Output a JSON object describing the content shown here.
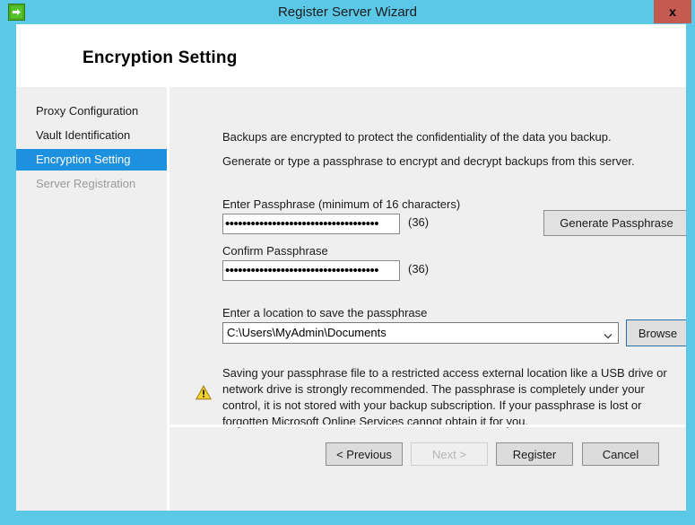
{
  "window": {
    "title": "Register Server Wizard",
    "app_icon": "arrow-right-green-icon",
    "close_label": "x",
    "frame_color": "#5bc8e8",
    "close_button_color": "#c45b50"
  },
  "header": {
    "page_title": "Encryption Setting"
  },
  "sidebar": {
    "items": [
      {
        "label": "Proxy Configuration",
        "state": "normal"
      },
      {
        "label": "Vault Identification",
        "state": "normal"
      },
      {
        "label": "Encryption Setting",
        "state": "active"
      },
      {
        "label": "Server Registration",
        "state": "disabled"
      }
    ],
    "active_color": "#1e90e0"
  },
  "main": {
    "intro_line_1": "Backups are encrypted to protect the confidentiality of the data you backup.",
    "intro_line_2": "Generate or type a passphrase to encrypt and decrypt backups from this server.",
    "enter_passphrase": {
      "label": "Enter Passphrase (minimum of 16 characters)",
      "value": "••••••••••••••••••••••••••••••••••••",
      "count": "(36)"
    },
    "confirm_passphrase": {
      "label": "Confirm Passphrase",
      "value": "••••••••••••••••••••••••••••••••••••",
      "count": "(36)"
    },
    "generate_button": "Generate Passphrase",
    "location": {
      "label": "Enter a location to save the passphrase",
      "value": "C:\\Users\\MyAdmin\\Documents",
      "chevron_icon": "chevron-down-icon"
    },
    "browse_button": "Browse",
    "warning": {
      "icon": "warning-triangle-icon",
      "icon_color": "#f2c200",
      "text": "Saving your passphrase file to a restricted access external location like a USB drive or network drive is strongly recommended. The passphrase is completely under your control, it is not stored with your backup subscription. If your passphrase is lost or forgotten Microsoft Online Services cannot obtain it for you."
    }
  },
  "footer": {
    "previous": "< Previous",
    "next": "Next >",
    "register": "Register",
    "cancel": "Cancel"
  }
}
